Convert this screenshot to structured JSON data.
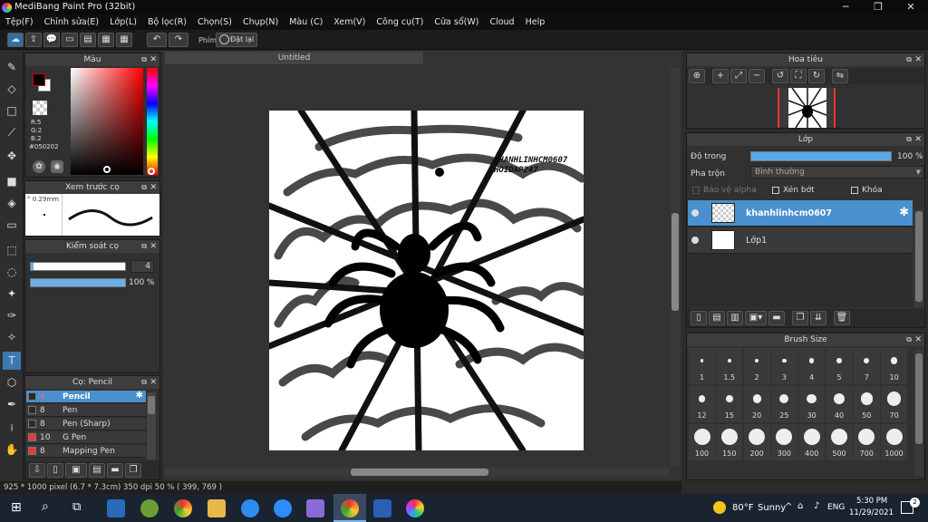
{
  "window": {
    "title": "MediBang Paint Pro (32bit)",
    "minimize": "─",
    "maximize": "❐",
    "close": "✕"
  },
  "menu": [
    "Tệp(F)",
    "Chỉnh sửa(E)",
    "Lớp(L)",
    "Bộ lọc(R)",
    "Chọn(S)",
    "Chụp(N)",
    "Màu (C)",
    "Xem(V)",
    "Công cụ(T)",
    "Cửa sổ(W)",
    "Cloud",
    "Help"
  ],
  "toolbar": {
    "phim_label": "Phím",
    "reset_label": "Đặt lại"
  },
  "color_panel": {
    "title": "Màu",
    "r": "R:5",
    "g": "G:2",
    "b": "B:2",
    "hex": "#050202",
    "primary": "#050202"
  },
  "brush_preview": {
    "title": "Xem trước cọ",
    "size": "0.29mm"
  },
  "brush_control": {
    "title": "Kiểm soát cọ",
    "size_value": "4",
    "opacity_value": "100 %"
  },
  "brush_panel": {
    "title": "Cọ: Pencil",
    "items": [
      {
        "size": "4",
        "name": "Pencil",
        "color": "#2a2a2a"
      },
      {
        "size": "8",
        "name": "Pen",
        "color": "#2a2a2a"
      },
      {
        "size": "8",
        "name": "Pen (Sharp)",
        "color": "#2a2a2a"
      },
      {
        "size": "10",
        "name": "G Pen",
        "color": "#e23b3b"
      },
      {
        "size": "8",
        "name": "Mapping Pen",
        "color": "#e23b3b"
      }
    ]
  },
  "document": {
    "tab": "Untitled",
    "watermark_line1": "KHANHLINHCM0607",
    "watermark_line2": "HOIDAP247"
  },
  "status": {
    "info": "925 * 1000 pixel   (6.7 * 7.3cm)   350 dpi   50 %   ( 399, 769 )"
  },
  "navigator": {
    "title": "Hoa tiêu"
  },
  "layer_panel": {
    "title": "Lớp",
    "opacity_label": "Độ trong",
    "opacity_value": "100 %",
    "opacity_fraction": 1.0,
    "blend_label": "Pha trộn",
    "blend_value": "Bình thường",
    "protect_alpha": "Bảo vệ alpha",
    "clipping": "Xén bớt",
    "lock": "Khóa",
    "layers": [
      {
        "name": "khanhlinhcm0607",
        "selected": true
      },
      {
        "name": "Lớp1",
        "selected": false
      }
    ]
  },
  "brush_size": {
    "title": "Brush Size",
    "rows": [
      [
        "1",
        "1.5",
        "2",
        "3",
        "4",
        "5",
        "7",
        "10"
      ],
      [
        "12",
        "15",
        "20",
        "25",
        "30",
        "40",
        "50",
        "70"
      ],
      [
        "100",
        "150",
        "200",
        "300",
        "400",
        "500",
        "700",
        "1000"
      ]
    ]
  },
  "taskbar": {
    "weather_temp": "80°F",
    "weather_text": "Sunny",
    "lang": "ENG",
    "time": "5:30 PM",
    "date": "11/29/2021",
    "notif_count": "2"
  }
}
